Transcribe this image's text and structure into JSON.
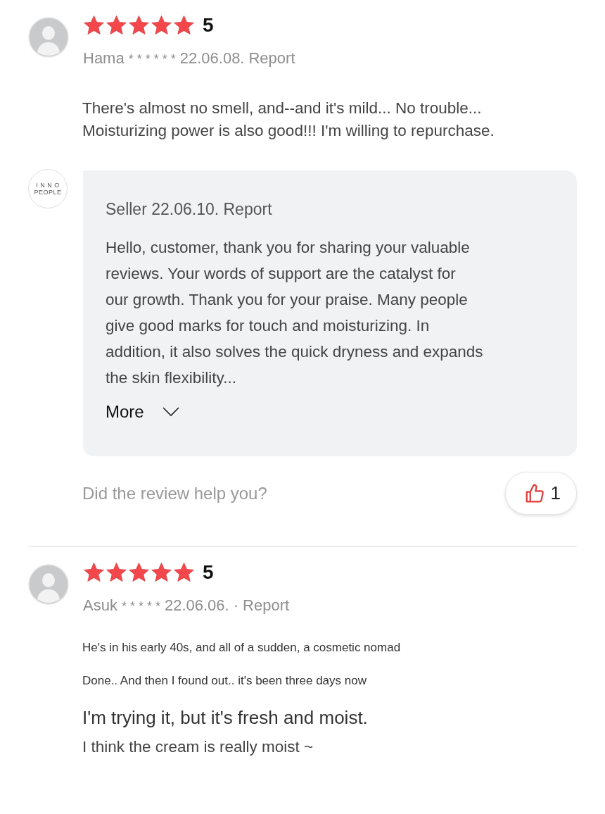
{
  "reviews": [
    {
      "stars": 5,
      "score": "5",
      "author": "Hama",
      "masked": "* * * * * *",
      "date": "22.06.08.",
      "report": "Report",
      "body": [
        {
          "kind": "normal",
          "text": "There's almost no smell, and--and it's mild... No trouble...\nMoisturizing power is also good!!! I'm willing to repurchase."
        }
      ],
      "seller_reply": {
        "logo_lines": [
          "I N N O",
          "PEOPLE"
        ],
        "meta": "Seller 22.06.10. Report",
        "text": "Hello, customer, thank you for sharing your valuable\nreviews. Your words of support are the catalyst for\nour growth. Thank you for your praise. Many people\ngive good marks for touch and moisturizing. In\naddition, it also solves the quick dryness and expands\nthe skin flexibility...",
        "more": "More"
      },
      "help_prompt": "Did the review help you?",
      "likes": "1"
    },
    {
      "stars": 5,
      "score": "5",
      "author": "Asuk",
      "masked": "* * * * *",
      "date": "22.06.06.",
      "separator": "·",
      "report": "Report",
      "body": [
        {
          "kind": "small",
          "text": "He's in his early 40s, and all of a sudden, a cosmetic nomad"
        },
        {
          "kind": "small",
          "text": "Done.. And then I found out.. it's been three days now"
        },
        {
          "kind": "large",
          "text": "I'm trying it, but it's fresh and moist."
        },
        {
          "kind": "normal",
          "text": "I think the cream is really moist ~"
        }
      ]
    }
  ]
}
